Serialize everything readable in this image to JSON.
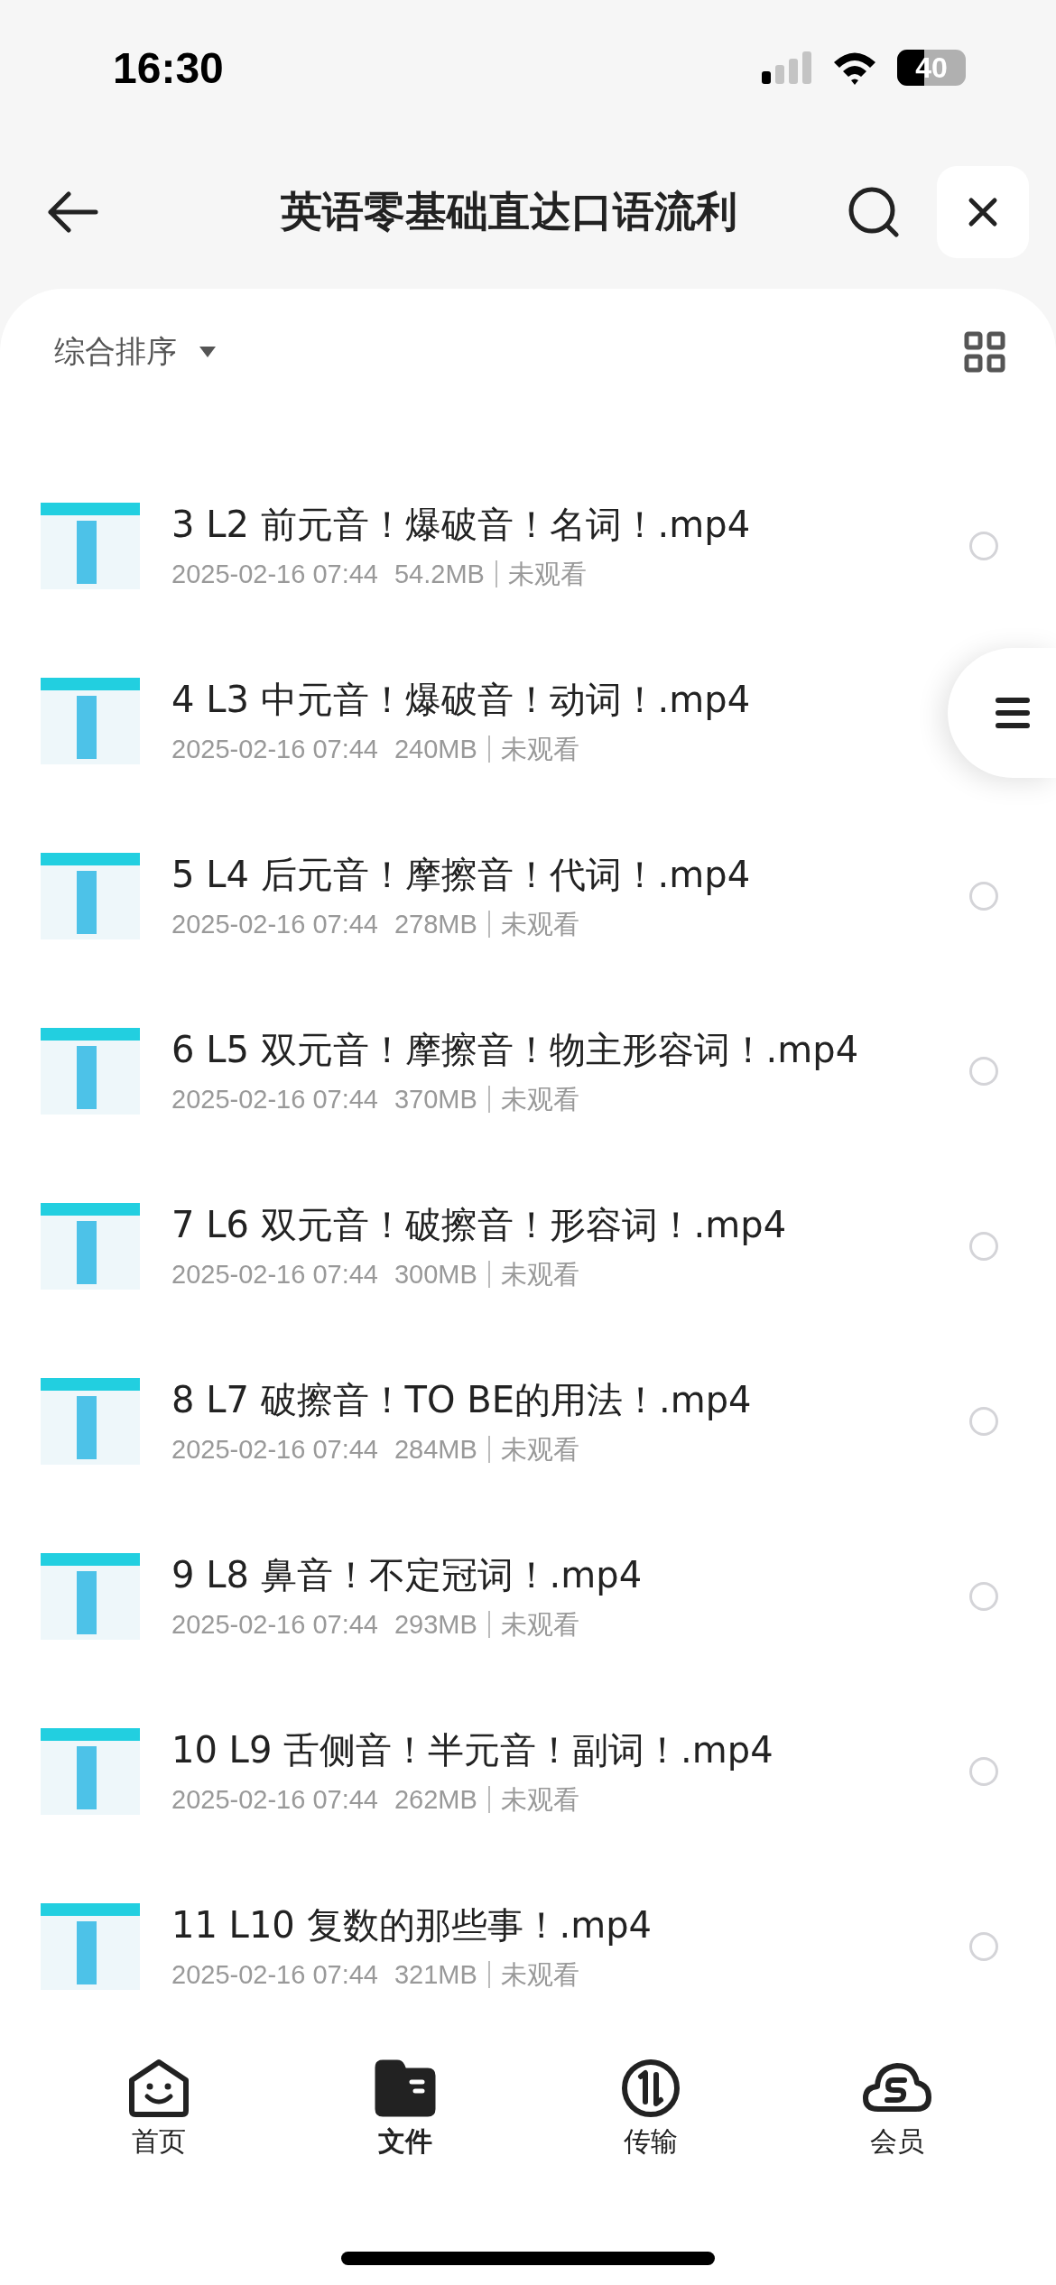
{
  "status_bar": {
    "time": "16:30",
    "battery": "40"
  },
  "header": {
    "title": "英语零基础直达口语流利"
  },
  "sort": {
    "label": "综合排序"
  },
  "files": [
    {
      "title": "3 L2 前元音！爆破音！名词！.mp4",
      "date": "2025-02-16 07:44",
      "size": "54.2MB",
      "status": "未观看",
      "selected": false
    },
    {
      "title": "4 L3 中元音！爆破音！动词！.mp4",
      "date": "2025-02-16 07:44",
      "size": "240MB",
      "status": "未观看"
    },
    {
      "title": "5 L4 后元音！摩擦音！代词！.mp4",
      "date": "2025-02-16 07:44",
      "size": "278MB",
      "status": "未观看",
      "selected": false
    },
    {
      "title": "6 L5 双元音！摩擦音！物主形容词！.mp4",
      "date": "2025-02-16 07:44",
      "size": "370MB",
      "status": "未观看",
      "selected": false
    },
    {
      "title": "7 L6 双元音！破擦音！形容词！.mp4",
      "date": "2025-02-16 07:44",
      "size": "300MB",
      "status": "未观看",
      "selected": false
    },
    {
      "title": "8 L7 破擦音！TO BE的用法！.mp4",
      "date": "2025-02-16 07:44",
      "size": "284MB",
      "status": "未观看",
      "selected": false
    },
    {
      "title": "9 L8 鼻音！不定冠词！.mp4",
      "date": "2025-02-16 07:44",
      "size": "293MB",
      "status": "未观看",
      "selected": false
    },
    {
      "title": "10 L9 舌侧音！半元音！副词！.mp4",
      "date": "2025-02-16 07:44",
      "size": "262MB",
      "status": "未观看",
      "selected": false
    },
    {
      "title": "11 L10 复数的那些事！.mp4",
      "date": "2025-02-16 07:44",
      "size": "321MB",
      "status": "未观看",
      "selected": false
    }
  ],
  "tabs": [
    {
      "label": "首页",
      "selected": false
    },
    {
      "label": "文件",
      "selected": true
    },
    {
      "label": "传输",
      "selected": false
    },
    {
      "label": "会员",
      "selected": false
    }
  ]
}
